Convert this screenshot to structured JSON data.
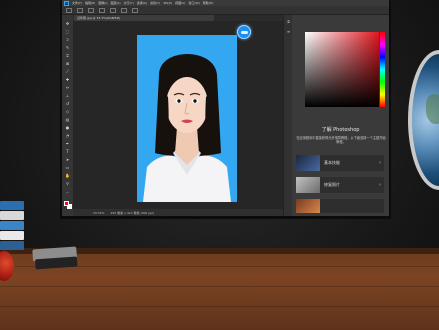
{
  "app": {
    "name": "Photoshop",
    "logo_text": "Ps",
    "menu": [
      "文件(F)",
      "编辑(E)",
      "图像(I)",
      "图层(L)",
      "文字(Y)",
      "选择(S)",
      "滤镜(T)",
      "3D(D)",
      "视图(V)",
      "窗口(W)",
      "帮助(H)"
    ]
  },
  "document": {
    "tab_title": "证件照.jpg @ 33.3%(RGB/8#)",
    "zoom": "33.33%",
    "size": "295 像素 x 413 像素 (300 ppi)"
  },
  "colors": {
    "foreground": "#e0171f",
    "background": "#ffffff",
    "photo_background": "#33a8f0",
    "accent": "#31a8ff"
  },
  "learn_panel": {
    "title": "了解 Photoshop",
    "description": "在应用程序中直接获得分步指导教程。从下面选择一个主题开始教程。",
    "items": [
      {
        "label": "基本技能",
        "arrow": "›"
      },
      {
        "label": "修复照片",
        "arrow": "›"
      },
      {
        "label": "",
        "arrow": ""
      }
    ]
  },
  "icons": {
    "cloud": "cloud-icon",
    "chevron": "chevron-right-icon"
  }
}
